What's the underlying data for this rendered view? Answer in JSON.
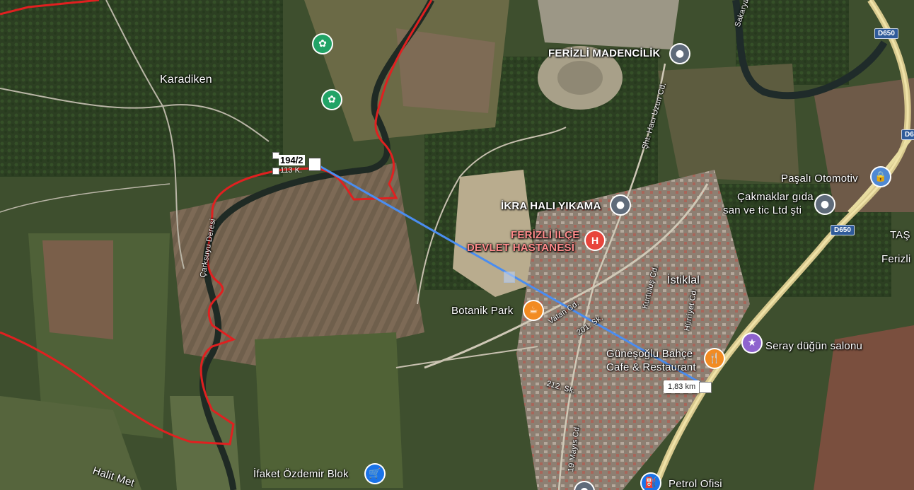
{
  "labels": {
    "karadiken": "Karadiken",
    "ferizli_madencilik": "FERİZLİ MADENCİLİK",
    "ikra": "İKRA HALI YIKAMA",
    "hastane_1": "FERİZLİ İLÇE",
    "hastane_2": "DEVLET HASTANESİ",
    "pasali": "Paşalı Otomotiv",
    "cakmaklar_1": "Çakmaklar gıda",
    "cakmaklar_2": "san ve tic Ltd şti",
    "istiklal": "İstiklal",
    "botanik": "Botanik Park",
    "gunesoglu_1": "Güneşoğlu Bahçe",
    "gunesoglu_2": "Cafe & Restaurant",
    "seray": "Seray düğün salonu",
    "ifaket": "İfaket Özdemir Blok",
    "petrol": "Petrol Ofisi",
    "ferizli_right": "Ferizli",
    "tas": "TAŞ",
    "halit": "Halit Met",
    "sakarya": "Sakarya",
    "carksuyu": "Çarksuyu Deresi",
    "sht_haci": "Şht. Hacı Uzun Cd.",
    "vatan": "Vatan Cd.",
    "sk201": "201. Sk.",
    "sk212": "212. Sk.",
    "mayis": "19 Mayıs Cd.",
    "kurtulus": "Kurtuluş Cd.",
    "hurriyet": "Hürriyet Cd."
  },
  "road_shields": {
    "d650_top": "D650",
    "d650_right": "D6",
    "d650_mid": "D650"
  },
  "parcel": {
    "number": "194/2",
    "sub": "113 K."
  },
  "distance": {
    "label": "1,83 km"
  },
  "icons": {
    "madencilik": "location-pin-icon",
    "ikra": "location-pin-icon",
    "hastane": "H",
    "pasali": "lock-icon",
    "cakmaklar": "location-pin-icon",
    "botanik": "cafe-cup-icon",
    "gunesoglu": "restaurant-fork-knife-icon",
    "seray": "event-venue-icon",
    "ifaket": "shopping-cart-icon",
    "petrol": "gas-station-icon",
    "park1": "flower-icon",
    "park2": "flower-icon"
  },
  "colors": {
    "measure_line": "#4a8df0",
    "boundary": "#e02020"
  }
}
